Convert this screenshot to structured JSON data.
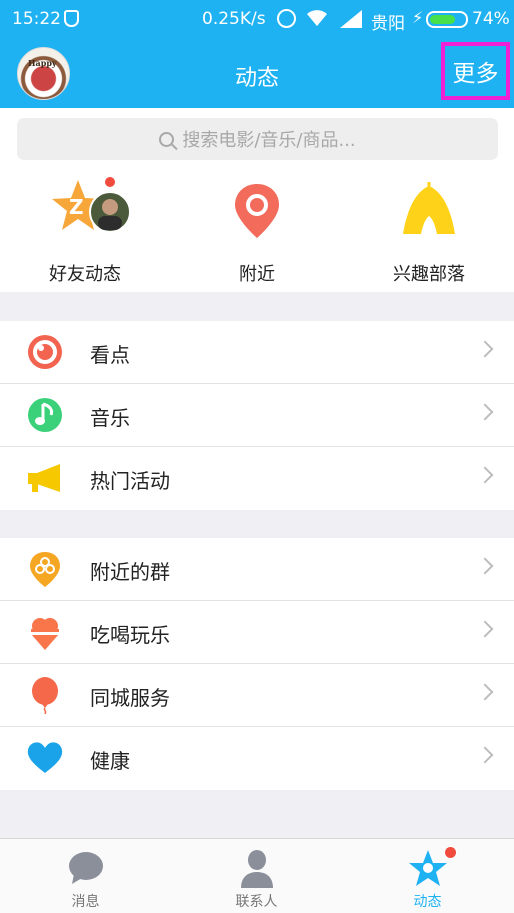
{
  "status_bar": {
    "time": "15:22",
    "net_speed": "0.25K/s",
    "carrier": "贵阳",
    "battery": "74%",
    "battery_level": 0.74
  },
  "header": {
    "title": "动态",
    "more_label": "更多",
    "avatar_text": "Happy"
  },
  "search": {
    "placeholder": "搜索电影/音乐/商品..."
  },
  "quick_entries": [
    {
      "label": "好友动态",
      "icon": "friends-feed-star-icon"
    },
    {
      "label": "附近",
      "icon": "location-pin-icon"
    },
    {
      "label": "兴趣部落",
      "icon": "tent-icon"
    }
  ],
  "sections": [
    {
      "items": [
        {
          "label": "看点",
          "icon": "eye-icon"
        },
        {
          "label": "音乐",
          "icon": "music-note-icon"
        },
        {
          "label": "热门活动",
          "icon": "megaphone-icon"
        }
      ]
    },
    {
      "items": [
        {
          "label": "附近的群",
          "icon": "group-pin-icon"
        },
        {
          "label": "吃喝玩乐",
          "icon": "ice-cream-icon"
        },
        {
          "label": "同城服务",
          "icon": "balloon-icon"
        },
        {
          "label": "健康",
          "icon": "heart-icon"
        }
      ]
    }
  ],
  "tabs": [
    {
      "label": "消息",
      "icon": "chat-bubble-icon"
    },
    {
      "label": "联系人",
      "icon": "contact-person-icon"
    },
    {
      "label": "动态",
      "icon": "star-icon",
      "active": true
    }
  ],
  "colors": {
    "brand": "#1fb2f2",
    "highlight_box": "#f021d5",
    "badge": "#f04b3c"
  }
}
